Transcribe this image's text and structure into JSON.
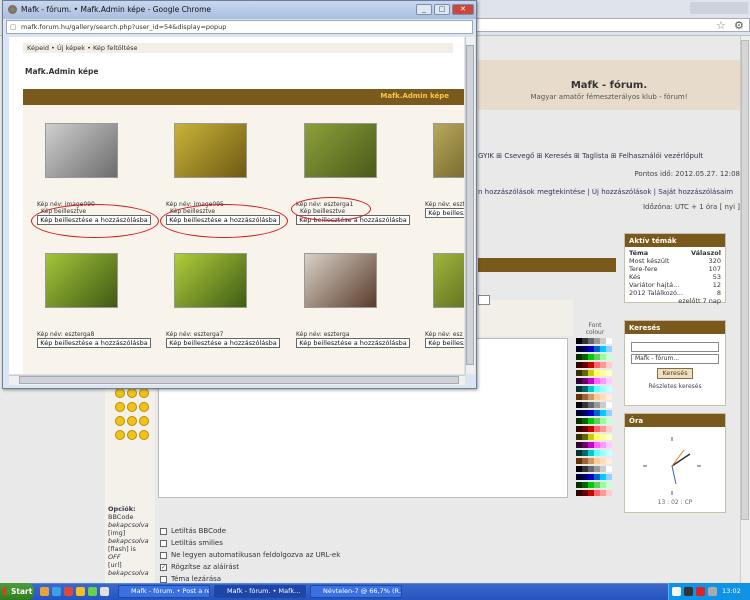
{
  "popup": {
    "title": "Mafk - fórum. • Mafk.Admin képe - Google Chrome",
    "url": "mafk.forum.hu/gallery/search.php?user_id=54&display=popup",
    "breadcrumb": "Képeid • Új képek • Kép feltöltése",
    "gallery_title": "Mafk.Admin képe",
    "bar_title": "Mafk.Admin képe",
    "items": [
      {
        "name": "Kép név: image090",
        "sub": "Kép beillesztve",
        "button": "Kép beillesztése a hozzászólásba"
      },
      {
        "name": "Kép név: image095",
        "sub": "Kép beillesztve",
        "button": "Kép beillesztése a hozzászólásba"
      },
      {
        "name": "Kép név: eszterga1",
        "sub": "Kép beillesztve",
        "button": "Kép beillesztése a hozzászólásba"
      },
      {
        "name": "Kép név: eszt",
        "sub": "",
        "button": "Kép beillesztése a hozzászólásba"
      },
      {
        "name": "Kép név: eszterga8",
        "sub": "",
        "button": "Kép beillesztése a hozzászólásba"
      },
      {
        "name": "Kép név: eszterga7",
        "sub": "",
        "button": "Kép beillesztése a hozzászólásba"
      },
      {
        "name": "Kép név: eszterga",
        "sub": "",
        "button": "Kép beillesztése a hozzászólásba"
      },
      {
        "name": "Kép név: esz",
        "sub": "",
        "button": "Kép beillesztése a hozzászólásba"
      }
    ],
    "btn_min": "_",
    "btn_max": "□",
    "btn_close": "✕"
  },
  "background": {
    "site_title": "Mafk - fórum.",
    "site_subtitle": "Magyar amatőr fémeszterályos klub - fórum!",
    "nav": "GYIK  ⊞ Csevegő  ⊞ Keresés  ⊞ Taglista  ⊞ Felhasználói vezérlőpult",
    "datetime": "Pontos idő: 2012.05.27. 12:08",
    "links": "n hozzászólások megtekintése | Új hozzászólások | Saját hozzászólásaim",
    "timezone": "Időzóna: UTC + 1 óra [ nyi ]",
    "font_label": "Font colour",
    "box_active": {
      "title": "Aktív témák",
      "col_topic": "Téma",
      "col_replies": "Válaszol",
      "rows": [
        {
          "topic": "Most készült",
          "replies": "320"
        },
        {
          "topic": "Tere-fere",
          "replies": "107"
        },
        {
          "topic": "Kés",
          "replies": "53"
        },
        {
          "topic": "Variátor hajtá...",
          "replies": "12"
        },
        {
          "topic": "2012 Találkozó...",
          "replies": "8"
        }
      ],
      "footer": "ezelőtt 7 nap"
    },
    "box_search": {
      "title": "Keresés",
      "select": "Mafk - fórum...",
      "button": "Keresés",
      "advanced": "Részletes keresés"
    },
    "box_clock": {
      "title": "Óra",
      "time": "13 : 02 : CP"
    },
    "options_title": "Opciók:",
    "options": [
      "BBCode",
      "bekapcsolva",
      "[img]",
      "bekapcsolva",
      "[flash] is",
      "OFF",
      "[url]",
      "bekapcsolva"
    ],
    "checkboxes": [
      "Letiltás BBCode",
      "Letiltás smilies",
      "Ne legyen automatikusan feldolgozva az URL-ek",
      "Rögzítse az aláírást",
      "Téma lezárása"
    ]
  },
  "taskbar": {
    "start": "Start",
    "tasks": [
      "Mafk - fórum. • Post a re...",
      "Mafk - fórum. • Mafk...",
      "Névtelen-7 @ 66,7% (R..."
    ],
    "clock": "13:02"
  },
  "colors": {
    "brown": "#7a5a1c",
    "gold": "#f5c74a",
    "red_oval": "#cc1d1d"
  }
}
